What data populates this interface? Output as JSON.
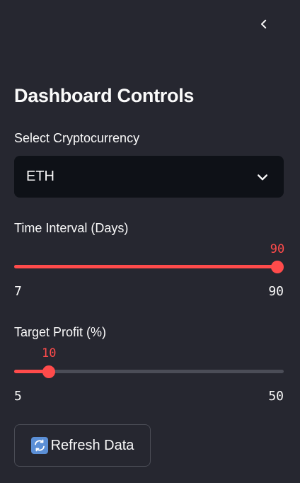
{
  "sidebar": {
    "collapse_icon": "chevron-left-icon",
    "heading": "Dashboard Controls",
    "crypto_select": {
      "label": "Select Cryptocurrency",
      "value": "ETH",
      "icon": "chevron-down-icon"
    },
    "time_interval": {
      "label": "Time Interval (Days)",
      "value": "90",
      "min": "7",
      "max": "90",
      "fraction": 1.0
    },
    "target_profit": {
      "label": "Target Profit (%)",
      "value": "10",
      "min": "5",
      "max": "50",
      "fraction": 0.111
    },
    "refresh_button": {
      "label": "Refresh Data",
      "icon": "refresh-icon"
    }
  },
  "colors": {
    "background": "#262730",
    "accent": "#ff4b4b",
    "input_bg": "#0e1117",
    "track": "#4b4d57"
  }
}
